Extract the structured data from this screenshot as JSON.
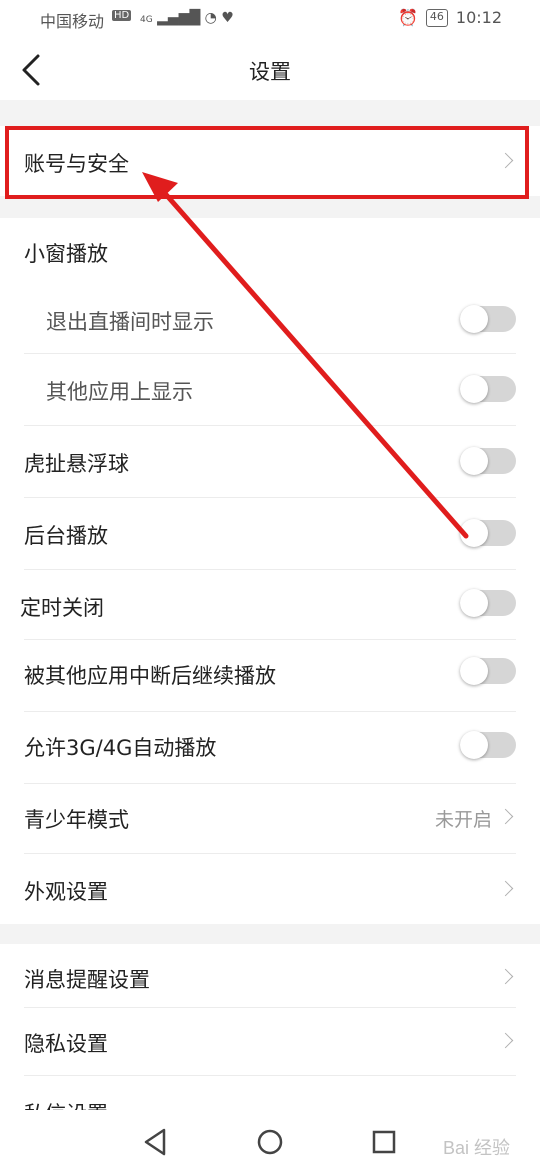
{
  "status_bar": {
    "carrier": "中国移动",
    "net_badge": "HD",
    "signal": "4G",
    "time": "10:12",
    "battery": "46"
  },
  "header": {
    "title": "设置"
  },
  "rows": {
    "account": "账号与安全",
    "mini_window": "小窗播放",
    "exit_live_show": "退出直播间时显示",
    "other_apps_show": "其他应用上显示",
    "float_ball": "虎扯悬浮球",
    "background_play": "后台播放",
    "timer_close": "定时关闭",
    "resume_after_interrupt": "被其他应用中断后继续播放",
    "auto_play_3g4g": "允许3G/4G自动播放",
    "teen_mode": "青少年模式",
    "teen_mode_value": "未开启",
    "appearance": "外观设置",
    "notifications": "消息提醒设置",
    "privacy": "隐私设置",
    "messages": "私信设置"
  },
  "toggles": {
    "exit_live_show": false,
    "other_apps_show": false,
    "float_ball": false,
    "background_play": false,
    "timer_close": false,
    "resume_after_interrupt": false,
    "auto_play_3g4g": false
  },
  "annotation": {
    "color": "#e01d1d"
  },
  "watermark": "Bai 经验"
}
